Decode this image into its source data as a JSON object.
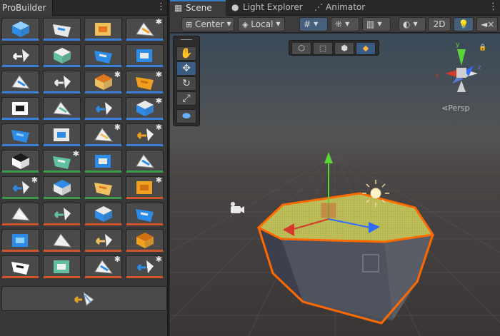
{
  "probuilder": {
    "tab_label": "ProBuilder",
    "menu_icon": "kebab-icon",
    "buttons": [
      {
        "icon": "new-shape-icon",
        "group": "obj"
      },
      {
        "icon": "new-poly-shape-icon",
        "group": "obj"
      },
      {
        "icon": "smoothing-icon",
        "group": "obj"
      },
      {
        "icon": "material-editor-icon",
        "group": "obj"
      },
      {
        "icon": "uv-editor-icon",
        "group": "obj"
      },
      {
        "icon": "vertex-colors-icon",
        "group": "obj"
      },
      {
        "icon": "select-faces-icon",
        "group": "obj"
      },
      {
        "icon": "add-face-icon",
        "group": "obj"
      },
      {
        "icon": "merge-faces-icon",
        "group": "obj"
      },
      {
        "icon": "mirror-icon",
        "group": "obj"
      },
      {
        "icon": "flip-normals-icon",
        "group": "obj"
      },
      {
        "icon": "conform-normals-icon",
        "group": "obj"
      },
      {
        "icon": "grow-selection-icon",
        "group": "obj"
      },
      {
        "icon": "select-path-icon",
        "group": "obj"
      },
      {
        "icon": "shrink-selection-icon",
        "group": "obj"
      },
      {
        "icon": "select-hole-icon",
        "group": "obj"
      },
      {
        "icon": "select-loop-icon",
        "group": "obj"
      },
      {
        "icon": "select-material-icon",
        "group": "obj"
      },
      {
        "icon": "generate-uv2-icon",
        "group": "obj"
      },
      {
        "icon": "subdivide-icon",
        "group": "obj"
      },
      {
        "icon": "center-pivot-icon",
        "group": "vert"
      },
      {
        "icon": "freeze-transform-icon",
        "group": "vert"
      },
      {
        "icon": "set-trigger-icon",
        "group": "vert"
      },
      {
        "icon": "weld-vertices-icon",
        "group": "vert"
      },
      {
        "icon": "export-icon",
        "group": "vert"
      },
      {
        "icon": "triangulate-icon",
        "group": "vert"
      },
      {
        "icon": "extrude-icon",
        "group": "vert"
      },
      {
        "icon": "subdivide-edges-icon",
        "group": "face"
      },
      {
        "icon": "split-vertices-icon",
        "group": "face"
      },
      {
        "icon": "bevel-icon",
        "group": "face"
      },
      {
        "icon": "detach-faces-icon",
        "group": "face"
      },
      {
        "icon": "connect-icon",
        "group": "face"
      },
      {
        "icon": "collapse-icon",
        "group": "face"
      },
      {
        "icon": "delete-faces-icon",
        "group": "face"
      },
      {
        "icon": "duplicate-faces-icon",
        "group": "face"
      },
      {
        "icon": "insert-edge-loop-icon",
        "group": "face"
      },
      {
        "icon": "fill-hole-icon",
        "group": "face"
      },
      {
        "icon": "bridge-edges-icon",
        "group": "face"
      },
      {
        "icon": "offset-elements-icon",
        "group": "face"
      },
      {
        "icon": "set-pivot-icon",
        "group": "face"
      }
    ],
    "wide_button_icon": "flip-edge-icon"
  },
  "scene": {
    "tabs": [
      {
        "label": "Scene",
        "icon": "grid-icon"
      },
      {
        "label": "Light Explorer",
        "icon": "bulb-icon"
      },
      {
        "label": "Animator",
        "icon": "animator-icon"
      }
    ],
    "menu_icon": "kebab-icon",
    "toolbar": {
      "pivot_mode": "Center",
      "pivot_rotation": "Local",
      "mode_2d": "2D"
    },
    "overlay_tools": [
      "hand-tool-icon",
      "move-tool-icon",
      "rotate-tool-icon",
      "scale-tool-icon",
      "probuilder-tool-icon"
    ],
    "select_modes": [
      "object-mode-icon",
      "vertex-mode-icon",
      "edge-mode-icon",
      "face-mode-icon"
    ],
    "gizmo_label": "Persp",
    "gizmo_axes": [
      "y",
      "x",
      "z"
    ]
  },
  "colors": {
    "accent": "#3a79bb",
    "selection_outline": "#ff6a00",
    "face_highlight": "#ffff55",
    "gizmo_x": "#d6382b",
    "gizmo_y": "#5bd63a",
    "gizmo_z": "#2f6bff"
  }
}
